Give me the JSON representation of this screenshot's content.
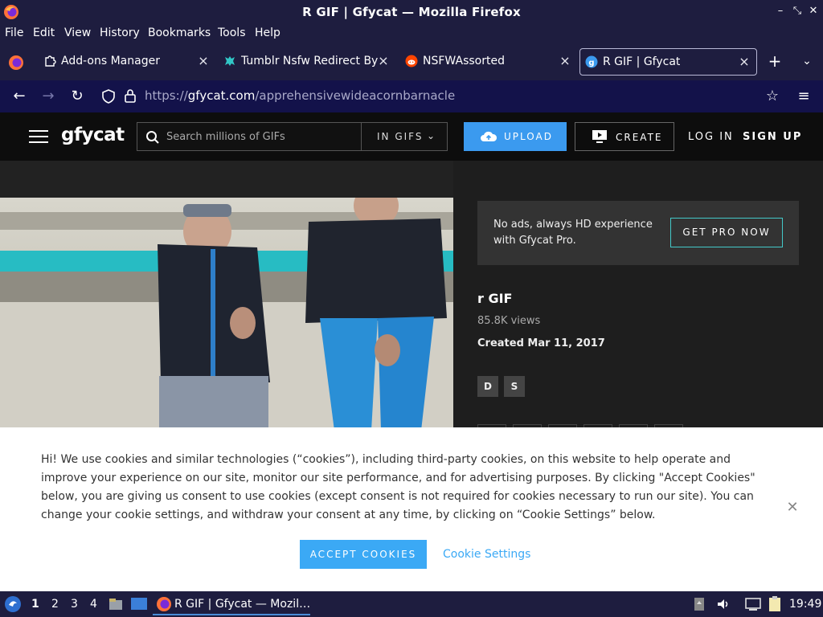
{
  "window": {
    "title": "R GIF | Gfycat — Mozilla Firefox"
  },
  "menu": [
    "File",
    "Edit",
    "View",
    "History",
    "Bookmarks",
    "Tools",
    "Help"
  ],
  "tabs": [
    {
      "label": "Add-ons Manager",
      "icon": "puzzle-icon"
    },
    {
      "label": "Tumblr Nsfw Redirect Byp",
      "icon": "tumblr-extension-icon"
    },
    {
      "label": "NSFWAssorted",
      "icon": "reddit-icon"
    },
    {
      "label": "R GIF | Gfycat",
      "icon": "gfycat-icon",
      "active": true
    }
  ],
  "navbar": {
    "url_prefix": "https://",
    "url_host": "gfycat.com",
    "url_path": "/apprehensivewideacornbarnacle"
  },
  "site": {
    "logo": "gfycat",
    "search_placeholder": "Search millions of GIFs",
    "search_scope": "IN GIFS",
    "upload": "UPLOAD",
    "create": "CREATE",
    "login": "LOG IN",
    "signup": "SIGN UP",
    "accent": "#3b9aef"
  },
  "promo": {
    "text": "No ads, always HD experience with Gfycat Pro.",
    "button": "GET PRO NOW"
  },
  "gif": {
    "title": "r GIF",
    "views": "85.8K views",
    "created": "Created Mar 11, 2017",
    "tags": [
      "D",
      "S"
    ]
  },
  "cookie": {
    "text": "Hi! We use cookies and similar technologies (“cookies”), including third-party cookies, on this website to help operate and improve your experience on our site, monitor our site performance, and for advertising purposes. By clicking \"Accept Cookies\" below, you are giving us consent to use cookies (except consent is not required for cookies necessary to run our site). You can change your cookie settings, and withdraw your consent at any time, by clicking on “Cookie Settings” below.",
    "accept": "ACCEPT COOKIES",
    "settings": "Cookie Settings"
  },
  "taskbar": {
    "workspaces": [
      "1",
      "2",
      "3",
      "4"
    ],
    "task_label": "R GIF | Gfycat — Mozil…",
    "clock": "19:49"
  }
}
